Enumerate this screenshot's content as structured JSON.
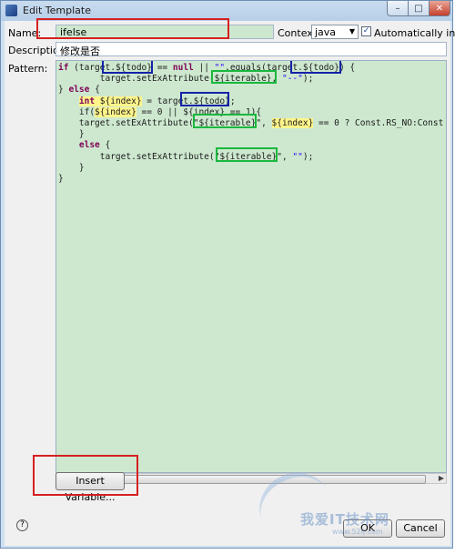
{
  "window": {
    "title": "Edit Template",
    "min_label": "–",
    "max_label": "□",
    "close_label": "✕"
  },
  "form": {
    "name_label": "Name:",
    "name_value": "ifelse",
    "context_label": "Context:",
    "context_value": "java",
    "auto_insert_label": "Automatically insert",
    "auto_insert_checked": "✓",
    "description_label": "Description:",
    "description_value": "修改是否",
    "pattern_label": "Pattern:"
  },
  "pattern": {
    "l1a": "if",
    "l1b": " (target.",
    "l1c": "${todo}",
    "l1d": " == ",
    "l1e": "null",
    "l1f": " || ",
    "l1g": "\"\"",
    "l1h": ".equals(target.",
    "l1i": "${todo}",
    "l1j": ") {",
    "l2a": "        target.setExAttribute(",
    "l2b": "${iterable}",
    "l2c": ", ",
    "l2d": "\"--\"",
    "l2e": ");",
    "l3a": "} ",
    "l3b": "else",
    "l3c": " {",
    "l4a": "    ",
    "l4b": "int",
    "l4c": " ",
    "l4d": "${index}",
    "l4e": " = target.",
    "l4f": "${todo}",
    "l4g": ";",
    "l5a": "    if(",
    "l5b": "${index}",
    "l5c": " == 0 || ",
    "l5d": "${index}",
    "l5e": " == 1){",
    "l6a": "    target.setExAttribute(\"",
    "l6b": "${iterable}",
    "l6c": "\", ",
    "l6d": "${index}",
    "l6e": " == 0 ? Const.RS_NO:Const",
    "l7": "    }",
    "l8a": "    ",
    "l8b": "else",
    "l8c": " {",
    "l9a": "        target.setExAttribute(\"",
    "l9b": "${iterable}",
    "l9c": "\", ",
    "l9d": "\"\"",
    "l9e": ");",
    "l10": "    }",
    "l11": "}"
  },
  "buttons": {
    "insert_variable": "Insert Variable...",
    "ok": "OK",
    "cancel": "Cancel",
    "help": "?"
  },
  "watermark": {
    "text": "我爱IT技术网",
    "url": "www.52ij.com"
  },
  "colors": {
    "editor_bg": "#cde8cf",
    "annotation_red": "#d62020",
    "annotation_blue": "#1522a8",
    "annotation_green": "#1ab83e",
    "annotation_yellow": "#fff58a"
  }
}
